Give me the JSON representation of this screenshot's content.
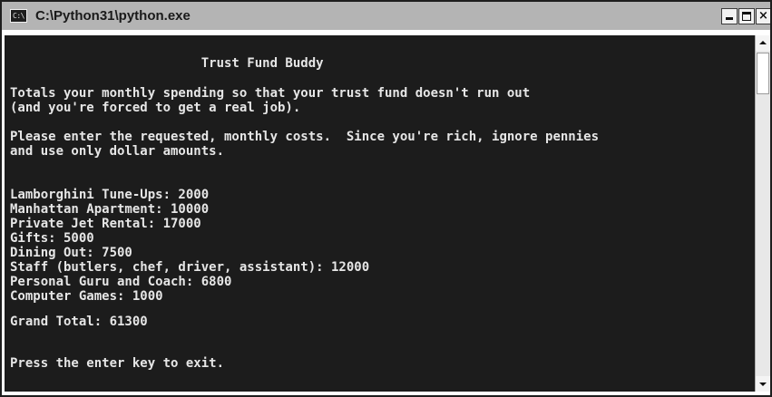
{
  "window": {
    "title": "C:\\Python31\\python.exe",
    "icon": "console-app-icon",
    "icon_glyph": "C:\\",
    "buttons": {
      "minimize": "minimize-icon",
      "maximize": "maximize-icon",
      "close": "close-icon",
      "close_glyph": "×"
    }
  },
  "console": {
    "lines": [
      "                         Trust Fund Buddy",
      "Totals your monthly spending so that your trust fund doesn't run out",
      "(and you're forced to get a real job).",
      "Please enter the requested, monthly costs.  Since you're rich, ignore pennies",
      "and use only dollar amounts.",
      "Lamborghini Tune-Ups: 2000",
      "Manhattan Apartment: 10000",
      "Private Jet Rental: 17000",
      "Gifts: 5000",
      "Dining Out: 7500",
      "Staff (butlers, chef, driver, assistant): 12000",
      "Personal Guru and Coach: 6800",
      "Computer Games: 1000",
      "Grand Total: 61300",
      "Press the enter key to exit."
    ]
  },
  "scrollbar": {
    "up": "scroll-up-arrow-icon",
    "down": "scroll-down-arrow-icon"
  },
  "colors": {
    "console_background": "#1c1c1c",
    "console_text": "#e6e6e6",
    "titlebar": "#b4b4b4"
  }
}
